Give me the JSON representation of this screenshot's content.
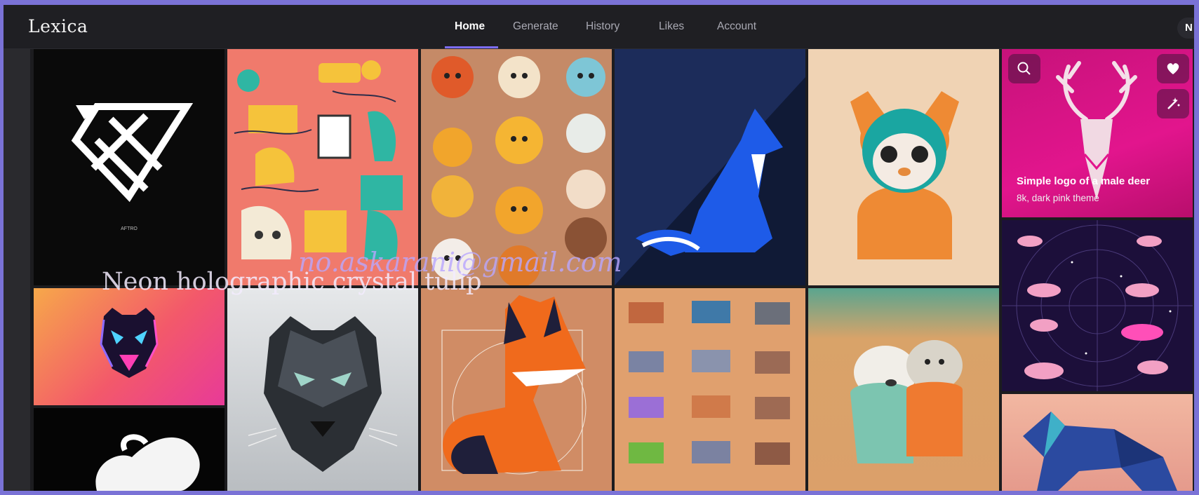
{
  "app": {
    "logo": "Lexica"
  },
  "nav": {
    "items": [
      {
        "label": "Home",
        "active": true
      },
      {
        "label": "Generate"
      },
      {
        "label": "History"
      },
      {
        "label": "Likes"
      },
      {
        "label": "Account"
      }
    ],
    "avatar_initial": "N"
  },
  "gallery": {
    "logo_tile_text": "AFTRO",
    "hover_card": {
      "title": "Simple logo of a male deer",
      "subtitle": "8k, dark pink theme",
      "icons": [
        "search-icon",
        "heart-icon",
        "magic-wand-icon"
      ]
    }
  },
  "overlays": {
    "prompt_text": "Neon holographic crystal tulip",
    "email_watermark": "no.askarani@gmail.com"
  },
  "colors": {
    "accent": "#7c6cf0",
    "frame": "#7a72d6",
    "background": "#1c1c1f"
  }
}
